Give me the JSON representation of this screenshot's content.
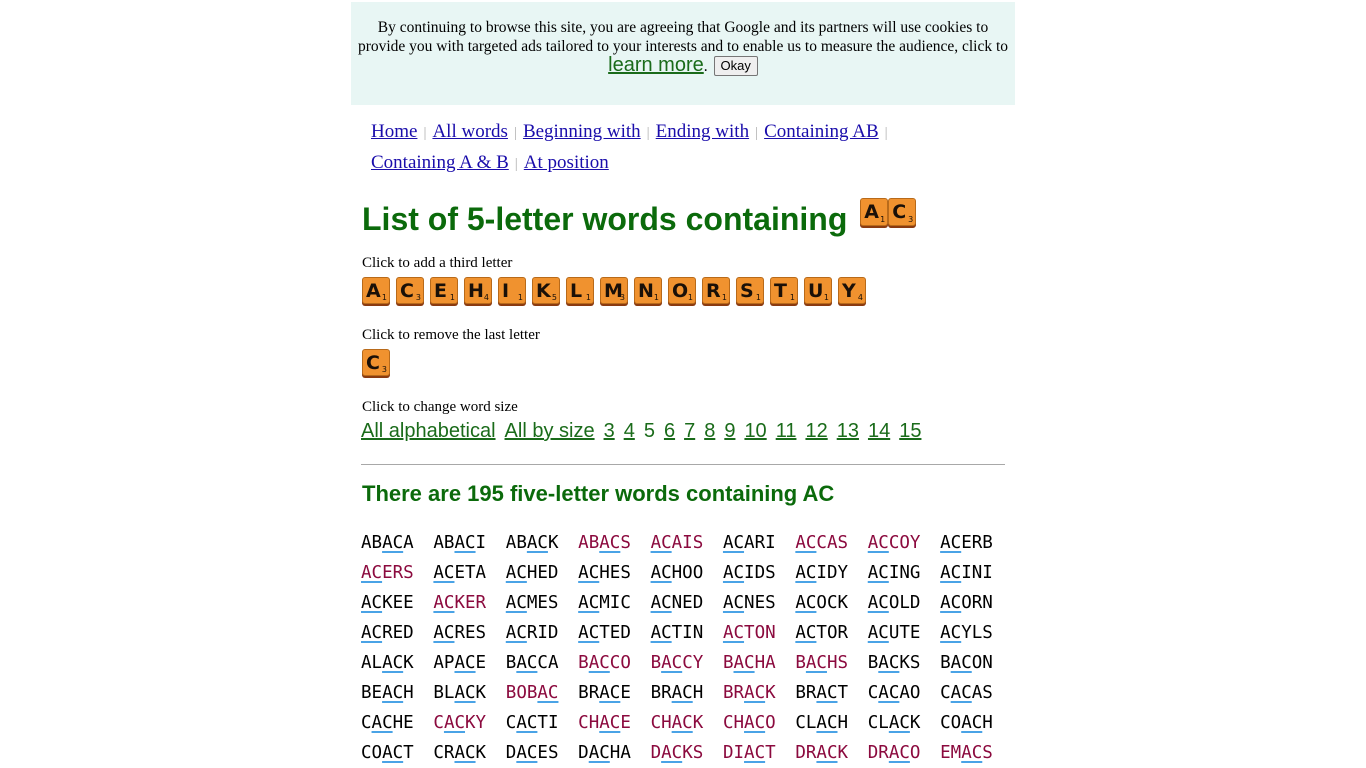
{
  "cookie_banner": {
    "text": "By continuing to browse this site, you are agreeing that Google and its partners will use cookies to provide you with targeted ads tailored to your interests and to enable us to measure the audience, click to",
    "link_label": "learn more",
    "after_link": ".",
    "button_label": "Okay"
  },
  "nav": {
    "items": [
      {
        "label": "Home"
      },
      {
        "label": "All words"
      },
      {
        "label": "Beginning with"
      },
      {
        "label": "Ending with"
      },
      {
        "label": "Containing AB"
      },
      {
        "label": "Containing A & B"
      },
      {
        "label": "At position"
      }
    ],
    "separator": "|"
  },
  "title": {
    "text": "List of 5-letter words containing",
    "tiles": [
      {
        "letter": "A",
        "score": "1"
      },
      {
        "letter": "C",
        "score": "3"
      }
    ]
  },
  "add_letter": {
    "label": "Click to add a third letter",
    "tiles": [
      {
        "letter": "A",
        "score": "1"
      },
      {
        "letter": "C",
        "score": "3"
      },
      {
        "letter": "E",
        "score": "1"
      },
      {
        "letter": "H",
        "score": "4"
      },
      {
        "letter": "I",
        "score": "1"
      },
      {
        "letter": "K",
        "score": "5"
      },
      {
        "letter": "L",
        "score": "1"
      },
      {
        "letter": "M",
        "score": "3"
      },
      {
        "letter": "N",
        "score": "1"
      },
      {
        "letter": "O",
        "score": "1"
      },
      {
        "letter": "R",
        "score": "1"
      },
      {
        "letter": "S",
        "score": "1"
      },
      {
        "letter": "T",
        "score": "1"
      },
      {
        "letter": "U",
        "score": "1"
      },
      {
        "letter": "Y",
        "score": "4"
      }
    ]
  },
  "remove_letter": {
    "label": "Click to remove the last letter",
    "tile": {
      "letter": "C",
      "score": "3"
    }
  },
  "word_size": {
    "label": "Click to change word size",
    "links": [
      "All alphabetical",
      "All by size",
      "3",
      "4",
      "5",
      "6",
      "7",
      "8",
      "9",
      "10",
      "11",
      "12",
      "13",
      "14",
      "15"
    ],
    "current": "5"
  },
  "results": {
    "heading": "There are 195 five-letter words containing AC",
    "colors": {
      "common": "#000000",
      "rare": "#8b0a3e",
      "highlight_underline": "#4aa3e6"
    },
    "words": [
      {
        "w": "ABACA",
        "hl": [
          2,
          3
        ],
        "rare": false
      },
      {
        "w": "ABACI",
        "hl": [
          2,
          3
        ],
        "rare": false
      },
      {
        "w": "ABACK",
        "hl": [
          2,
          3
        ],
        "rare": false
      },
      {
        "w": "ABACS",
        "hl": [
          2,
          3
        ],
        "rare": true
      },
      {
        "w": "ACAIS",
        "hl": [
          0,
          1
        ],
        "rare": true
      },
      {
        "w": "ACARI",
        "hl": [
          0,
          1
        ],
        "rare": false
      },
      {
        "w": "ACCAS",
        "hl": [
          0,
          1
        ],
        "rare": true
      },
      {
        "w": "ACCOY",
        "hl": [
          0,
          1
        ],
        "rare": true
      },
      {
        "w": "ACERB",
        "hl": [
          0,
          1
        ],
        "rare": false
      },
      {
        "w": "ACERS",
        "hl": [
          0,
          1
        ],
        "rare": true
      },
      {
        "w": "ACETA",
        "hl": [
          0,
          1
        ],
        "rare": false
      },
      {
        "w": "ACHED",
        "hl": [
          0,
          1
        ],
        "rare": false
      },
      {
        "w": "ACHES",
        "hl": [
          0,
          1
        ],
        "rare": false
      },
      {
        "w": "ACHOO",
        "hl": [
          0,
          1
        ],
        "rare": false
      },
      {
        "w": "ACIDS",
        "hl": [
          0,
          1
        ],
        "rare": false
      },
      {
        "w": "ACIDY",
        "hl": [
          0,
          1
        ],
        "rare": false
      },
      {
        "w": "ACING",
        "hl": [
          0,
          1
        ],
        "rare": false
      },
      {
        "w": "ACINI",
        "hl": [
          0,
          1
        ],
        "rare": false
      },
      {
        "w": "ACKEE",
        "hl": [
          0,
          1
        ],
        "rare": false
      },
      {
        "w": "ACKER",
        "hl": [
          0,
          1
        ],
        "rare": true
      },
      {
        "w": "ACMES",
        "hl": [
          0,
          1
        ],
        "rare": false
      },
      {
        "w": "ACMIC",
        "hl": [
          0,
          1
        ],
        "rare": false
      },
      {
        "w": "ACNED",
        "hl": [
          0,
          1
        ],
        "rare": false
      },
      {
        "w": "ACNES",
        "hl": [
          0,
          1
        ],
        "rare": false
      },
      {
        "w": "ACOCK",
        "hl": [
          0,
          1
        ],
        "rare": false
      },
      {
        "w": "ACOLD",
        "hl": [
          0,
          1
        ],
        "rare": false
      },
      {
        "w": "ACORN",
        "hl": [
          0,
          1
        ],
        "rare": false
      },
      {
        "w": "ACRED",
        "hl": [
          0,
          1
        ],
        "rare": false
      },
      {
        "w": "ACRES",
        "hl": [
          0,
          1
        ],
        "rare": false
      },
      {
        "w": "ACRID",
        "hl": [
          0,
          1
        ],
        "rare": false
      },
      {
        "w": "ACTED",
        "hl": [
          0,
          1
        ],
        "rare": false
      },
      {
        "w": "ACTIN",
        "hl": [
          0,
          1
        ],
        "rare": false
      },
      {
        "w": "ACTON",
        "hl": [
          0,
          1
        ],
        "rare": true
      },
      {
        "w": "ACTOR",
        "hl": [
          0,
          1
        ],
        "rare": false
      },
      {
        "w": "ACUTE",
        "hl": [
          0,
          1
        ],
        "rare": false
      },
      {
        "w": "ACYLS",
        "hl": [
          0,
          1
        ],
        "rare": false
      },
      {
        "w": "ALACK",
        "hl": [
          2,
          3
        ],
        "rare": false
      },
      {
        "w": "APACE",
        "hl": [
          2,
          3
        ],
        "rare": false
      },
      {
        "w": "BACCA",
        "hl": [
          1,
          2
        ],
        "rare": false
      },
      {
        "w": "BACCO",
        "hl": [
          1,
          2
        ],
        "rare": true
      },
      {
        "w": "BACCY",
        "hl": [
          1,
          2
        ],
        "rare": true
      },
      {
        "w": "BACHA",
        "hl": [
          1,
          2
        ],
        "rare": true
      },
      {
        "w": "BACHS",
        "hl": [
          1,
          2
        ],
        "rare": true
      },
      {
        "w": "BACKS",
        "hl": [
          1,
          2
        ],
        "rare": false
      },
      {
        "w": "BACON",
        "hl": [
          1,
          2
        ],
        "rare": false
      },
      {
        "w": "BEACH",
        "hl": [
          2,
          3
        ],
        "rare": false
      },
      {
        "w": "BLACK",
        "hl": [
          2,
          3
        ],
        "rare": false
      },
      {
        "w": "BOBAC",
        "hl": [
          3,
          4
        ],
        "rare": true
      },
      {
        "w": "BRACE",
        "hl": [
          2,
          3
        ],
        "rare": false
      },
      {
        "w": "BRACH",
        "hl": [
          2,
          3
        ],
        "rare": false
      },
      {
        "w": "BRACK",
        "hl": [
          2,
          3
        ],
        "rare": true
      },
      {
        "w": "BRACT",
        "hl": [
          2,
          3
        ],
        "rare": false
      },
      {
        "w": "CACAO",
        "hl": [
          1,
          2
        ],
        "rare": false
      },
      {
        "w": "CACAS",
        "hl": [
          1,
          2
        ],
        "rare": false
      },
      {
        "w": "CACHE",
        "hl": [
          1,
          2
        ],
        "rare": false
      },
      {
        "w": "CACKY",
        "hl": [
          1,
          2
        ],
        "rare": true
      },
      {
        "w": "CACTI",
        "hl": [
          1,
          2
        ],
        "rare": false
      },
      {
        "w": "CHACE",
        "hl": [
          2,
          3
        ],
        "rare": true
      },
      {
        "w": "CHACK",
        "hl": [
          2,
          3
        ],
        "rare": true
      },
      {
        "w": "CHACO",
        "hl": [
          2,
          3
        ],
        "rare": true
      },
      {
        "w": "CLACH",
        "hl": [
          2,
          3
        ],
        "rare": false
      },
      {
        "w": "CLACK",
        "hl": [
          2,
          3
        ],
        "rare": false
      },
      {
        "w": "COACH",
        "hl": [
          2,
          3
        ],
        "rare": false
      },
      {
        "w": "COACT",
        "hl": [
          2,
          3
        ],
        "rare": false
      },
      {
        "w": "CRACK",
        "hl": [
          2,
          3
        ],
        "rare": false
      },
      {
        "w": "DACES",
        "hl": [
          1,
          2
        ],
        "rare": false
      },
      {
        "w": "DACHA",
        "hl": [
          1,
          2
        ],
        "rare": false
      },
      {
        "w": "DACKS",
        "hl": [
          1,
          2
        ],
        "rare": true
      },
      {
        "w": "DIACT",
        "hl": [
          2,
          3
        ],
        "rare": true
      },
      {
        "w": "DRACK",
        "hl": [
          2,
          3
        ],
        "rare": true
      },
      {
        "w": "DRACO",
        "hl": [
          2,
          3
        ],
        "rare": true
      },
      {
        "w": "EMACS",
        "hl": [
          2,
          3
        ],
        "rare": true
      }
    ]
  }
}
